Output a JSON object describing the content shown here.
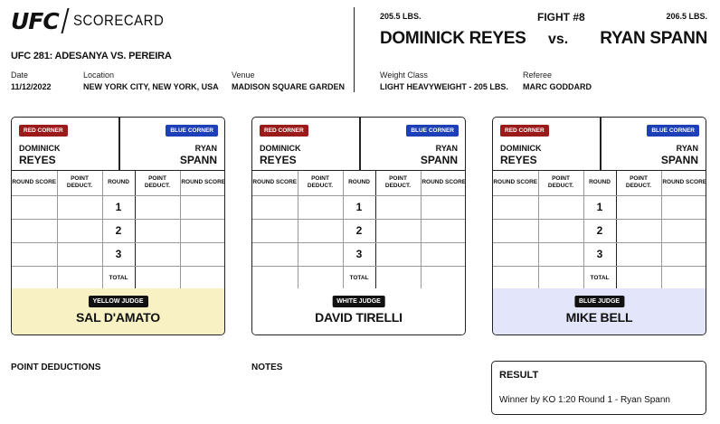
{
  "brand": {
    "logo": "UFC",
    "subtitle": "SCORECARD"
  },
  "event": {
    "title": "UFC 281: ADESANYA VS. PEREIRA",
    "date_label": "Date",
    "date": "11/12/2022",
    "location_label": "Location",
    "location": "NEW YORK CITY, NEW YORK, USA",
    "venue_label": "Venue",
    "venue": "MADISON SQUARE GARDEN"
  },
  "fight": {
    "number": "FIGHT #8",
    "red_weight": "205.5 LBS.",
    "blue_weight": "206.5 LBS.",
    "red_name": "DOMINICK REYES",
    "blue_name": "RYAN SPANN",
    "vs": "vs.",
    "weight_class_label": "Weight Class",
    "weight_class": "LIGHT HEAVYWEIGHT - 205 LBS.",
    "referee_label": "Referee",
    "referee": "MARC GODDARD"
  },
  "card_labels": {
    "red_corner": "RED CORNER",
    "blue_corner": "BLUE CORNER",
    "red_first": "DOMINICK",
    "red_last": "REYES",
    "blue_first": "RYAN",
    "blue_last": "SPANN",
    "col_round_score": "ROUND SCORE",
    "col_point_deduct": "POINT DEDUCT.",
    "col_round": "ROUND",
    "rounds": [
      "1",
      "2",
      "3"
    ],
    "total": "TOTAL"
  },
  "judges": [
    {
      "tag": "YELLOW JUDGE",
      "name": "SAL D'AMATO",
      "color": "#f7f1c4"
    },
    {
      "tag": "WHITE JUDGE",
      "name": "DAVID TIRELLI",
      "color": "#ffffff"
    },
    {
      "tag": "BLUE JUDGE",
      "name": "MIKE BELL",
      "color": "#e3e6fb"
    }
  ],
  "bottom": {
    "point_deductions": "POINT DEDUCTIONS",
    "notes": "NOTES",
    "result_title": "RESULT",
    "result_text": "Winner by KO 1:20 Round 1 - Ryan Spann"
  },
  "colors": {
    "red_corner": "#9b1b1b",
    "blue_corner": "#1d3fb8"
  }
}
